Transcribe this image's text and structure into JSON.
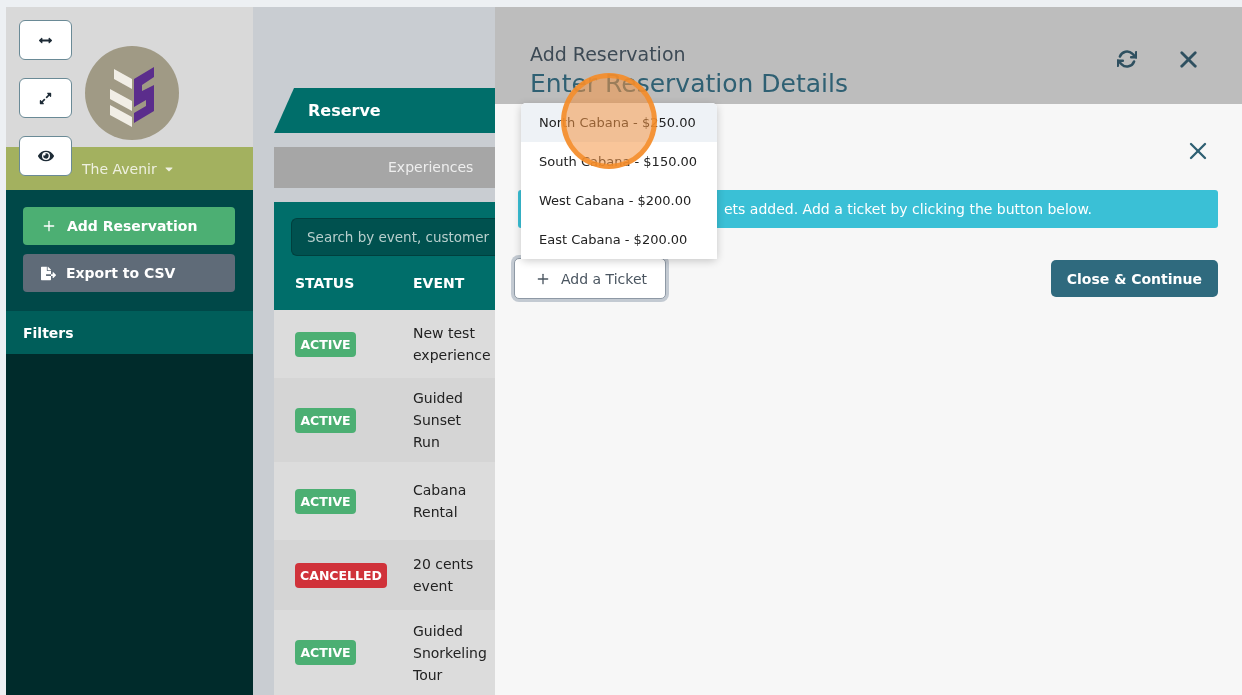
{
  "sidebar": {
    "venue": "The Avenir",
    "actions": [
      {
        "kind": "add",
        "label": "Add Reservation"
      },
      {
        "kind": "export",
        "label": "Export to CSV"
      }
    ],
    "filters_label": "Filters"
  },
  "main": {
    "tab": "Reserve",
    "subtab": "Experiences",
    "search": {
      "placeholder": "Search by event, customer"
    },
    "table": {
      "columns": [
        "STATUS",
        "EVENT"
      ],
      "rows": [
        {
          "status": "ACTIVE",
          "kind": "active",
          "event": "New test experience"
        },
        {
          "status": "ACTIVE",
          "kind": "active",
          "event": "Guided Sunset Run"
        },
        {
          "status": "ACTIVE",
          "kind": "active",
          "event": "Cabana Rental"
        },
        {
          "status": "CANCELLED",
          "kind": "cancelled",
          "event": "20 cents event"
        },
        {
          "status": "ACTIVE",
          "kind": "active",
          "event": "Guided Snorkeling Tour"
        }
      ]
    }
  },
  "panel": {
    "title": "Add Reservation",
    "subtitle": "Enter Reservation Details",
    "alert": "ets added. Add a ticket by clicking the button below.",
    "add_ticket": "Add a Ticket",
    "continue": "Close & Continue",
    "ticket_menu": [
      {
        "label": "North Cabana - $250.00",
        "selected": true
      },
      {
        "label": "South Cabana - $150.00",
        "selected": false
      },
      {
        "label": "West Cabana - $200.00",
        "selected": false
      },
      {
        "label": "East Cabana - $200.00",
        "selected": false
      }
    ]
  }
}
